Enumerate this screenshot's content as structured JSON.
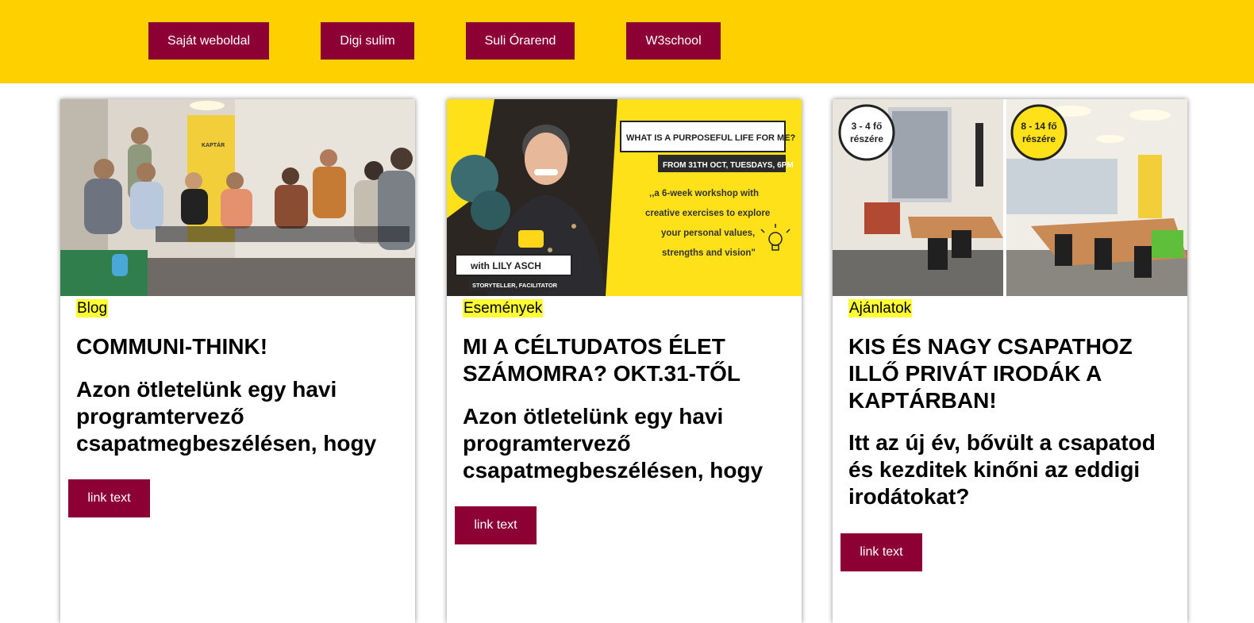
{
  "nav": {
    "items": [
      {
        "label": "Saját weboldal"
      },
      {
        "label": "Digi sulim"
      },
      {
        "label": "Suli Órarend"
      },
      {
        "label": "W3school"
      }
    ]
  },
  "cards": [
    {
      "category": "Blog",
      "title": "COMMUNI-THINK!",
      "excerpt": "Azon ötletelünk egy havi programtervező csapatmegbeszélésen, hogy",
      "link": "link text",
      "image_sign": "KAPTÁR"
    },
    {
      "category": "Események",
      "title": "MI A CÉLTUDATOS ÉLET SZÁMOMRA? OKT.31-TŐL",
      "excerpt": "Azon ötletelünk egy havi programtervező csapatmegbeszélésen, hogy",
      "link": "link text",
      "poster": {
        "headline": "WHAT IS A PURPOSEFUL LIFE FOR ME?",
        "date": "FROM 31TH OCT, TUESDAYS, 6PM",
        "quote_lines": [
          ",,a 6-week workshop with",
          "creative exercises to explore",
          "your personal values,",
          "strengths and vision\""
        ],
        "host": "with LILY ASCH",
        "role": "STORYTELLER, FACILITATOR"
      }
    },
    {
      "category": "Ajánlatok",
      "title": "KIS ÉS NAGY CSAPATHOZ ILLŐ PRIVÁT IRODÁK A KAPTÁRBAN!",
      "excerpt": "Itt az új év, bővült a csapatod és kezditek kinőni az eddigi irodátokat?",
      "link": "link text",
      "badges": [
        {
          "top": "3 - 4 fő",
          "bottom": "részére"
        },
        {
          "top": "8 - 14 fő",
          "bottom": "részére"
        }
      ]
    }
  ],
  "colors": {
    "topbar": "#ffd000",
    "button": "#8c0033",
    "category_highlight": "#ffff33"
  }
}
